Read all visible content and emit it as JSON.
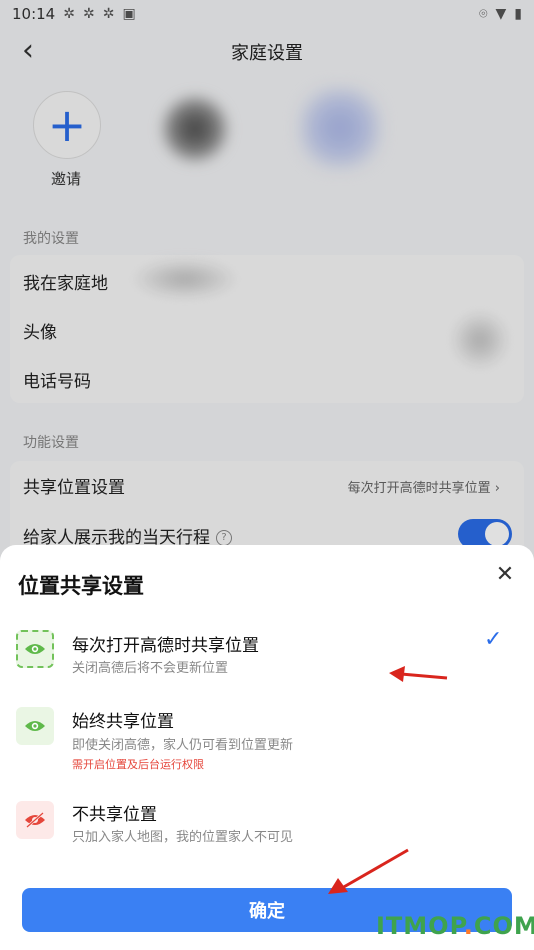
{
  "status_bar": {
    "time": "10:14",
    "icons_left": [
      "settings-icon",
      "settings-icon",
      "settings-icon",
      "a-icon"
    ],
    "icons_right": [
      "location-icon",
      "wifi-icon",
      "battery-icon"
    ]
  },
  "header": {
    "title": "家庭设置",
    "back_icon": "chevron-left-icon"
  },
  "members": {
    "invite_label": "邀请",
    "invite_icon": "plus-icon"
  },
  "my_settings": {
    "section_label": "我的设置",
    "rows": [
      "我在家庭地",
      "头像",
      "电话号码"
    ]
  },
  "function_settings": {
    "section_label": "功能设置",
    "share_location_label": "共享位置设置",
    "share_location_value": "每次打开高德时共享位置",
    "show_itinerary_label": "给家人展示我的当天行程",
    "show_itinerary_on": true
  },
  "sheet": {
    "title": "位置共享设置",
    "options": [
      {
        "title": "每次打开高德时共享位置",
        "desc": "关闭高德后将不会更新位置",
        "warn": "",
        "icon": "eye-icon",
        "selected": true
      },
      {
        "title": "始终共享位置",
        "desc": "即使关闭高德，家人仍可看到位置更新",
        "warn": "需开启位置及后台运行权限",
        "icon": "eye-icon",
        "selected": false
      },
      {
        "title": "不共享位置",
        "desc": "只加入家人地图，我的位置家人不可见",
        "warn": "",
        "icon": "eye-off-icon",
        "selected": false
      }
    ],
    "confirm_label": "确定"
  },
  "watermark": {
    "brand": "ITMOP",
    "dot": ".",
    "tld": "COM"
  },
  "colors": {
    "accent": "#3a80f3",
    "green": "#72c25a",
    "red": "#e5463b"
  }
}
